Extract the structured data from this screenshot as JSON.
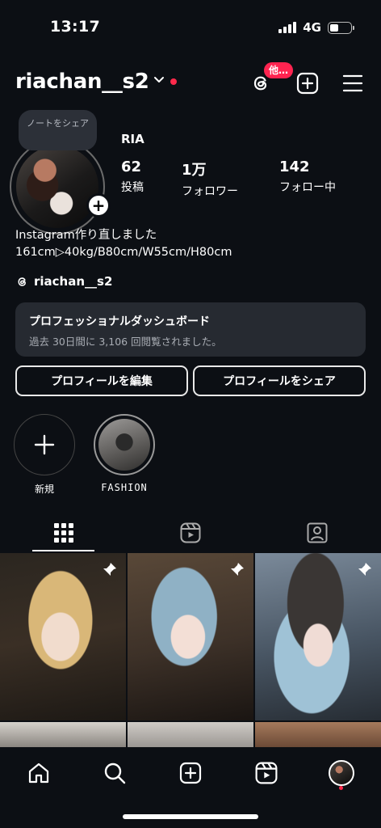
{
  "status_bar": {
    "time": "13:17",
    "network": "4G"
  },
  "header": {
    "username": "riachan__s2",
    "threads_badge": "他…"
  },
  "note_bubble": "ノートをシェア",
  "profile": {
    "display_name": "RIA",
    "stats": [
      {
        "value": "62",
        "label": "投稿"
      },
      {
        "value": "1万",
        "label": "フォロワー"
      },
      {
        "value": "142",
        "label": "フォロー中"
      }
    ],
    "bio_lines": [
      "Instagram作り直しました",
      "161cm▷40kg/B80cm/W55cm/H80cm"
    ],
    "threads_handle": "riachan__s2"
  },
  "dashboard": {
    "title": "プロフェッショナルダッシュボード",
    "subtitle": "過去 30日間に 3,106 回閲覧されました。"
  },
  "buttons": {
    "edit": "プロフィールを編集",
    "share": "プロフィールをシェア"
  },
  "highlights": [
    {
      "label": "新規"
    },
    {
      "label": "FASHION"
    }
  ],
  "tabs": [
    "grid-icon",
    "reels-icon",
    "tagged-icon"
  ],
  "colors": {
    "background": "#0c0f14",
    "accent_red": "#ff2a4b",
    "card": "#262a31"
  }
}
